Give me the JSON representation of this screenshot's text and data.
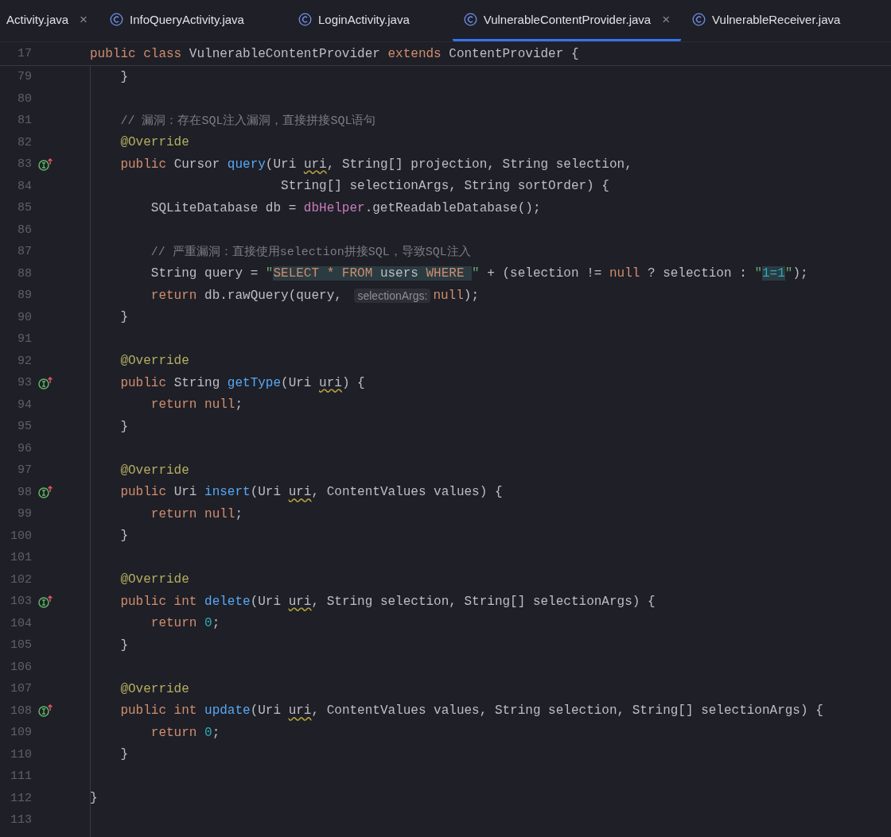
{
  "tabs": [
    {
      "label": "Activity.java",
      "icon": false,
      "closable": true,
      "selected": false
    },
    {
      "label": "InfoQueryActivity.java",
      "icon": true,
      "closable": false,
      "selected": false
    },
    {
      "label": "LoginActivity.java",
      "icon": true,
      "closable": false,
      "selected": false
    },
    {
      "label": "VulnerableContentProvider.java",
      "icon": true,
      "closable": true,
      "selected": true
    },
    {
      "label": "VulnerableReceiver.java",
      "icon": true,
      "closable": false,
      "selected": false
    }
  ],
  "close_mark": "×",
  "sticky_line": {
    "n": "17",
    "tokens": [
      {
        "t": "public class ",
        "kind": "kw"
      },
      {
        "t": "VulnerableContentProvider ",
        "kind": "text"
      },
      {
        "t": "extends ",
        "kind": "kw"
      },
      {
        "t": "ContentProvider {",
        "kind": "text"
      }
    ]
  },
  "lines": [
    {
      "n": "79",
      "tokens": [
        {
          "t": "    }",
          "kind": "text"
        }
      ]
    },
    {
      "n": "80"
    },
    {
      "n": "81",
      "tokens": [
        {
          "t": "    // 漏洞：存在SQL注入漏洞，直接拼接SQL语句",
          "kind": "comment"
        }
      ]
    },
    {
      "n": "82",
      "tokens": [
        {
          "t": "    @Override",
          "kind": "anno"
        }
      ]
    },
    {
      "n": "83",
      "kind": "implements",
      "tokens": [
        {
          "t": "    public ",
          "kind": "kw"
        },
        {
          "t": "Cursor ",
          "kind": "text"
        },
        {
          "t": "query",
          "kind": "fn"
        },
        {
          "t": "(Uri ",
          "kind": "text"
        },
        {
          "t": "uri",
          "kind": "warn"
        },
        {
          "t": ", String[] projection, String selection,",
          "kind": "text"
        }
      ]
    },
    {
      "n": "84",
      "tokens": [
        {
          "t": "                         String[] selectionArgs, String sortOrder) {",
          "kind": "text"
        }
      ]
    },
    {
      "n": "85",
      "tokens": [
        {
          "t": "        SQLiteDatabase db = ",
          "kind": "text"
        },
        {
          "t": "dbHelper",
          "kind": "field"
        },
        {
          "t": ".getReadableDatabase();",
          "kind": "text"
        }
      ]
    },
    {
      "n": "86"
    },
    {
      "n": "87",
      "tokens": [
        {
          "t": "        // 严重漏洞：直接使用selection拼接SQL，导致SQL注入",
          "kind": "comment"
        }
      ]
    },
    {
      "n": "88",
      "tokens": [
        {
          "t": "        String query = ",
          "kind": "text"
        },
        {
          "t": "\"",
          "kind": "str"
        },
        {
          "t": "SELECT * FROM ",
          "kind": "hlkw"
        },
        {
          "t": "users ",
          "kind": "hltext"
        },
        {
          "t": "WHERE ",
          "kind": "hlkw"
        },
        {
          "t": "\"",
          "kind": "str"
        },
        {
          "t": " + (selection != ",
          "kind": "text"
        },
        {
          "t": "null",
          "kind": "kw"
        },
        {
          "t": " ? selection : ",
          "kind": "text"
        },
        {
          "t": "\"",
          "kind": "str"
        },
        {
          "t": "1=1",
          "kind": "hlnum"
        },
        {
          "t": "\"",
          "kind": "str"
        },
        {
          "t": ");",
          "kind": "text"
        }
      ]
    },
    {
      "n": "89",
      "tokens": [
        {
          "t": "        return ",
          "kind": "kw"
        },
        {
          "t": "db.rawQuery(query, ",
          "kind": "text"
        },
        {
          "t": "selectionArgs:",
          "kind": "inlay"
        },
        {
          "t": "null",
          "kind": "kw"
        },
        {
          "t": ");",
          "kind": "text"
        }
      ]
    },
    {
      "n": "90",
      "tokens": [
        {
          "t": "    }",
          "kind": "text"
        }
      ]
    },
    {
      "n": "91"
    },
    {
      "n": "92",
      "tokens": [
        {
          "t": "    @Override",
          "kind": "anno"
        }
      ]
    },
    {
      "n": "93",
      "kind": "implements",
      "tokens": [
        {
          "t": "    public ",
          "kind": "kw"
        },
        {
          "t": "String ",
          "kind": "text"
        },
        {
          "t": "getType",
          "kind": "fn"
        },
        {
          "t": "(Uri ",
          "kind": "text"
        },
        {
          "t": "uri",
          "kind": "warn"
        },
        {
          "t": ") {",
          "kind": "text"
        }
      ]
    },
    {
      "n": "94",
      "tokens": [
        {
          "t": "        return null",
          "kind": "kw"
        },
        {
          "t": ";",
          "kind": "text"
        }
      ]
    },
    {
      "n": "95",
      "tokens": [
        {
          "t": "    }",
          "kind": "text"
        }
      ]
    },
    {
      "n": "96"
    },
    {
      "n": "97",
      "tokens": [
        {
          "t": "    @Override",
          "kind": "anno"
        }
      ]
    },
    {
      "n": "98",
      "kind": "implements",
      "tokens": [
        {
          "t": "    public ",
          "kind": "kw"
        },
        {
          "t": "Uri ",
          "kind": "text"
        },
        {
          "t": "insert",
          "kind": "fn"
        },
        {
          "t": "(Uri ",
          "kind": "text"
        },
        {
          "t": "uri",
          "kind": "warn"
        },
        {
          "t": ", ContentValues values) {",
          "kind": "text"
        }
      ]
    },
    {
      "n": "99",
      "tokens": [
        {
          "t": "        return null",
          "kind": "kw"
        },
        {
          "t": ";",
          "kind": "text"
        }
      ]
    },
    {
      "n": "100",
      "tokens": [
        {
          "t": "    }",
          "kind": "text"
        }
      ]
    },
    {
      "n": "101"
    },
    {
      "n": "102",
      "tokens": [
        {
          "t": "    @Override",
          "kind": "anno"
        }
      ]
    },
    {
      "n": "103",
      "kind": "implements",
      "tokens": [
        {
          "t": "    public int ",
          "kind": "kw"
        },
        {
          "t": "delete",
          "kind": "fn"
        },
        {
          "t": "(Uri ",
          "kind": "text"
        },
        {
          "t": "uri",
          "kind": "warn"
        },
        {
          "t": ", String selection, String[] selectionArgs) {",
          "kind": "text"
        }
      ]
    },
    {
      "n": "104",
      "tokens": [
        {
          "t": "        return ",
          "kind": "kw"
        },
        {
          "t": "0",
          "kind": "num"
        },
        {
          "t": ";",
          "kind": "text"
        }
      ]
    },
    {
      "n": "105",
      "tokens": [
        {
          "t": "    }",
          "kind": "text"
        }
      ]
    },
    {
      "n": "106"
    },
    {
      "n": "107",
      "tokens": [
        {
          "t": "    @Override",
          "kind": "anno"
        }
      ]
    },
    {
      "n": "108",
      "kind": "implements",
      "tokens": [
        {
          "t": "    public int ",
          "kind": "kw"
        },
        {
          "t": "update",
          "kind": "fn"
        },
        {
          "t": "(Uri ",
          "kind": "text"
        },
        {
          "t": "uri",
          "kind": "warn"
        },
        {
          "t": ", ContentValues values, String selection, String[] selectionArgs) {",
          "kind": "text"
        }
      ]
    },
    {
      "n": "109",
      "tokens": [
        {
          "t": "        return ",
          "kind": "kw"
        },
        {
          "t": "0",
          "kind": "num"
        },
        {
          "t": ";",
          "kind": "text"
        }
      ]
    },
    {
      "n": "110",
      "tokens": [
        {
          "t": "    }",
          "kind": "text"
        }
      ]
    },
    {
      "n": "111"
    },
    {
      "n": "112",
      "tokens": [
        {
          "t": "}",
          "kind": "text"
        }
      ]
    },
    {
      "n": "113"
    }
  ]
}
